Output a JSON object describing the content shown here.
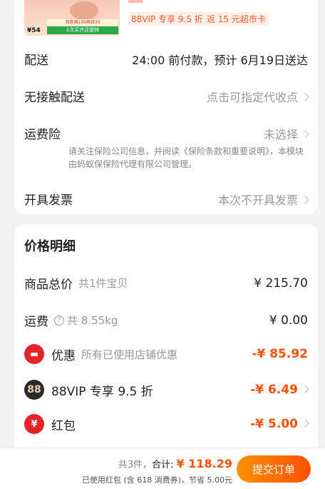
{
  "product": {
    "thumb_price": "¥54",
    "thumb_badge": "1次买齐还提快",
    "thumb_promo": "领券满199再减30",
    "vip_discount": "88VIP 专享 9.5 折",
    "cashback": "返 15 元超市卡"
  },
  "delivery": {
    "label": "配送",
    "value": "24:00 前付款，预计 6月19日送达"
  },
  "contactless": {
    "label": "无接触配送",
    "value": "点击可指定代收点"
  },
  "insurance": {
    "label": "运费险",
    "value": "未选择",
    "note": "请关注保险公司信息，并阅读《保险条款和重要说明》，本模块由蚂蚁保保险代理有限公司管理。"
  },
  "invoice": {
    "label": "开具发票",
    "value": "本次不开具发票"
  },
  "price_detail": {
    "title": "价格明细",
    "goods_label": "商品总价",
    "goods_sub": "共1件宝贝",
    "goods_amount": "¥ 215.70",
    "shipping_label": "运费",
    "shipping_sub": "共 8.55kg",
    "shipping_amount": "¥ 0.00",
    "discount_label": "优惠",
    "discount_sub": "所有已使用店铺优惠",
    "discount_amount": "-¥ 85.92",
    "vip_label": "88VIP 专享 9.5 折",
    "vip_amount": "-¥ 6.49",
    "redpack_label": "红包",
    "redpack_amount": "-¥ 5.00"
  },
  "icons": {
    "discount": "coupon-icon",
    "vip": "88vip-icon",
    "redpack": "red-envelope-icon",
    "help": "question-icon"
  },
  "footer": {
    "count": "共3件，",
    "total_label": "合计:",
    "total_amount": "¥ 118.29",
    "saving": "已使用红包 (含 618 消费券)，节省 5.00元",
    "submit": "提交订单"
  },
  "colors": {
    "accent": "#ff5000",
    "red": "#e5242a"
  }
}
